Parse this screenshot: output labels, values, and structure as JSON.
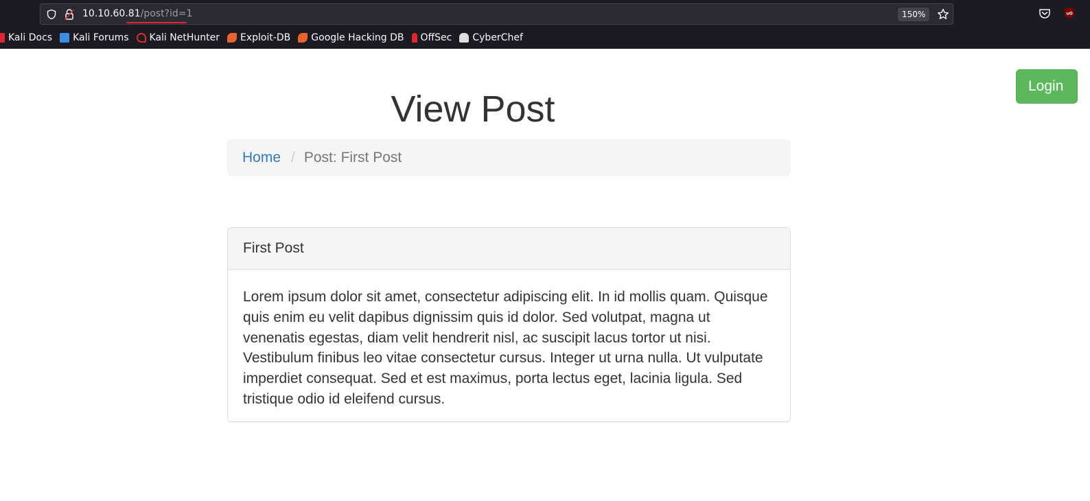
{
  "browser": {
    "url_host": "10.10.60.81",
    "url_path": "/post?id=1",
    "zoom": "150%",
    "bookmarks": [
      {
        "label": "Kali Docs",
        "icon": "kali-docs-icon",
        "color": "#e0262e"
      },
      {
        "label": "Kali Forums",
        "icon": "kali-forums-icon",
        "color": "#3a8ee6"
      },
      {
        "label": "Kali NetHunter",
        "icon": "kali-nethunter-icon",
        "color": "#e0262e"
      },
      {
        "label": "Exploit-DB",
        "icon": "exploit-db-icon",
        "color": "#e8642c"
      },
      {
        "label": "Google Hacking DB",
        "icon": "google-hacking-db-icon",
        "color": "#e8642c"
      },
      {
        "label": "OffSec",
        "icon": "offsec-icon",
        "color": "#e0262e"
      },
      {
        "label": "CyberChef",
        "icon": "cyberchef-icon",
        "color": "#dddddd"
      }
    ]
  },
  "page": {
    "login_label": "Login",
    "title": "View Post",
    "breadcrumb": {
      "home": "Home",
      "separator": "/",
      "current": "Post: First Post"
    },
    "post": {
      "title": "First Post",
      "body": "Lorem ipsum dolor sit amet, consectetur adipiscing elit. In id mollis quam. Quisque quis enim eu velit dapibus dignissim quis id dolor. Sed volutpat, magna ut venenatis egestas, diam velit hendrerit nisl, ac suscipit lacus tortor ut nisi. Vestibulum finibus leo vitae consectetur cursus. Integer ut urna nulla. Ut vulputate imperdiet consequat. Sed et est maximus, porta lectus eget, lacinia ligula. Sed tristique odio id eleifend cursus."
    }
  },
  "colors": {
    "accent_link": "#337ab7",
    "login_button": "#5cb85c",
    "chrome_bg": "#1c1b22"
  }
}
